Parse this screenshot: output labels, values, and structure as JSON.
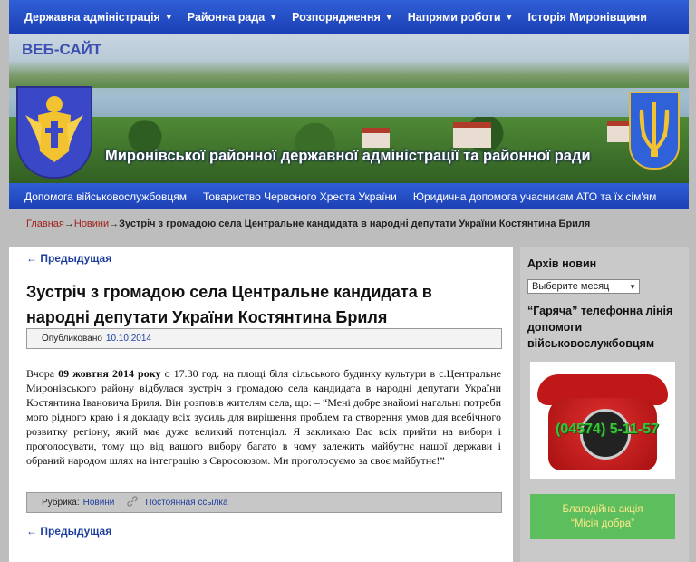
{
  "top_nav": {
    "items": [
      {
        "label": "Державна адміністрація",
        "has_dropdown": true
      },
      {
        "label": "Районна рада",
        "has_dropdown": true
      },
      {
        "label": "Розпорядження",
        "has_dropdown": true
      },
      {
        "label": "Напрями роботи",
        "has_dropdown": true
      },
      {
        "label": "Історія Миронівщини",
        "has_dropdown": false
      }
    ],
    "caret": "▼"
  },
  "banner": {
    "site_tag": "ВЕБ-САЙТ",
    "title": "Миронівської районної державної адміністрації та районної ради"
  },
  "sub_nav": {
    "items": [
      "Допомога військовослужбовцям",
      "Товариство Червоного Хреста України",
      "Юридична допомога учасникам АТО та їх сім'ям"
    ]
  },
  "breadcrumb": {
    "home": "Главная",
    "section": "Новини",
    "separator": "→",
    "current": "Зустріч з громадою села Центральне кандидата в народні депутати України Костянтина Бриля"
  },
  "post": {
    "prev_label": "← Предыдущая",
    "title": "Зустріч з громадою села Центральне кандидата в народні депутати України Костянтина Бриля",
    "published_label": "Опубликовано",
    "published_date": "10.10.2014",
    "body_prefix": "Вчора ",
    "body_date": "09 жовтня 2014 року",
    "body_text": " о 17.30 год. на площі біля сільського будинку культури в с.Центральне Миронівського району відбулася зустріч з громадою села кандидата в народні депутати України Костянтина Івановича Бриля. Він розповів жителям села, що: – “Мені добре знайомі нагальні потреби мого рідного краю і я докладу всіх зусиль для вирішення проблем та створення умов для всебічного розвитку регіону, який має дуже великий потенціал. Я закликаю Вас всіх прийти на вибори і проголосувати, тому що від вашого вибору багато в чому залежить майбутнє нашої держави і обраний народом шлях на інтеграцію з Євросоюзом. Ми проголосуємо за своє майбутнє!”",
    "category_label": "Рубрика:",
    "category": "Новини",
    "permalink": "Постоянная ссылка"
  },
  "sidebar": {
    "archive_heading": "Архів новин",
    "month_select": "Выберите месяц",
    "hotline_heading": "“Гаряча” телефонна лінія допомоги військовослужбовцям",
    "phone_number": "(04574) 5-11-57",
    "charity_line1": "Благодійна акція",
    "charity_line2": "“Місія добра”"
  },
  "colors": {
    "nav_blue": "#1f45c0",
    "link_blue": "#1f3f9e",
    "breadcrumb_red": "#a0201b",
    "charity_green": "#5dbe5d"
  }
}
